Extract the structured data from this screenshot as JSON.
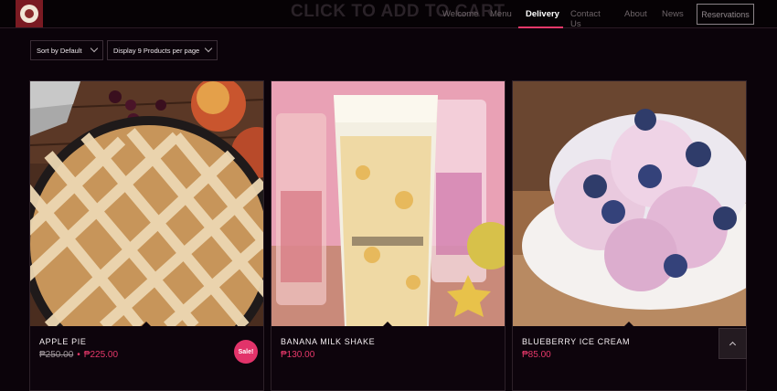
{
  "header": {
    "ghost_title": "CLICK TO ADD TO CART",
    "nav": [
      "Welcome",
      "Menu",
      "Delivery",
      "Contact Us",
      "About",
      "News"
    ],
    "active_nav": "Delivery",
    "reservations_label": "Reservations"
  },
  "filters": {
    "sort_label": "Sort by Default",
    "display_label": "Display 9 Products per page"
  },
  "products": [
    {
      "name": "Apple Pie",
      "old_price": "₱250.00",
      "separator": "•",
      "price": "₱225.00",
      "badge": "Sale!"
    },
    {
      "name": "Banana Milk Shake",
      "price": "₱130.00"
    },
    {
      "name": "Blueberry Ice Cream",
      "price": "₱85.00"
    }
  ],
  "colors": {
    "accent": "#e6386a",
    "background": "#0b030a"
  },
  "icons": {
    "scroll_top": "chevron-up-icon",
    "select": "chevron-down-icon"
  }
}
